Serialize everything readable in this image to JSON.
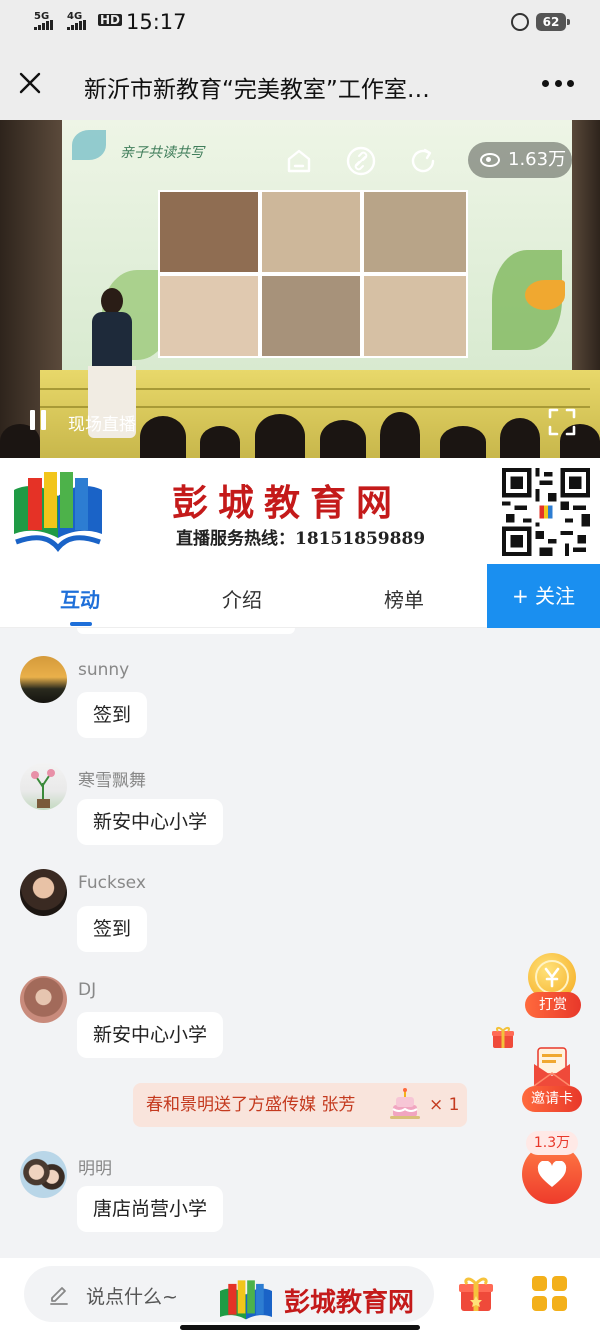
{
  "status_bar": {
    "network_1": "5G",
    "network_2": "4G",
    "hd": "HD",
    "time": "15:17",
    "battery": "62"
  },
  "header": {
    "title": "新沂市新教育“完美教室”工作室…"
  },
  "video": {
    "views": "1.63万",
    "live_label": "现场直播",
    "screen_caption": "亲子共读共写"
  },
  "banner": {
    "title": "彭城教育网",
    "hotline": "直播服务热线：18151859889"
  },
  "tabs": [
    {
      "label": "互动",
      "active": true
    },
    {
      "label": "介绍",
      "active": false
    },
    {
      "label": "榜单",
      "active": false
    }
  ],
  "follow_label": "+ 关注",
  "messages": [
    {
      "user": "sunny",
      "text": "签到"
    },
    {
      "user": "寒雪飘舞",
      "text": "新安中心小学"
    },
    {
      "user": "Fucksex",
      "text": "签到"
    },
    {
      "user": "DJ",
      "text": "新安中心小学"
    },
    {
      "user": "明明",
      "text": "唐店尚营小学"
    }
  ],
  "gift_notice": {
    "text": "春和景明送了方盛传媒 张芳",
    "count": "× 1"
  },
  "side": {
    "reward_label": "打赏",
    "invite_label": "邀请卡",
    "like_count": "1.3万"
  },
  "bottom": {
    "placeholder": "说点什么~",
    "watermark": "彭城教育网"
  },
  "colors": {
    "accent": "#1e6fd9",
    "follow_bg": "#1a8ff0",
    "brand_red": "#c41a1a",
    "action_orange": "#ee3b2b"
  }
}
